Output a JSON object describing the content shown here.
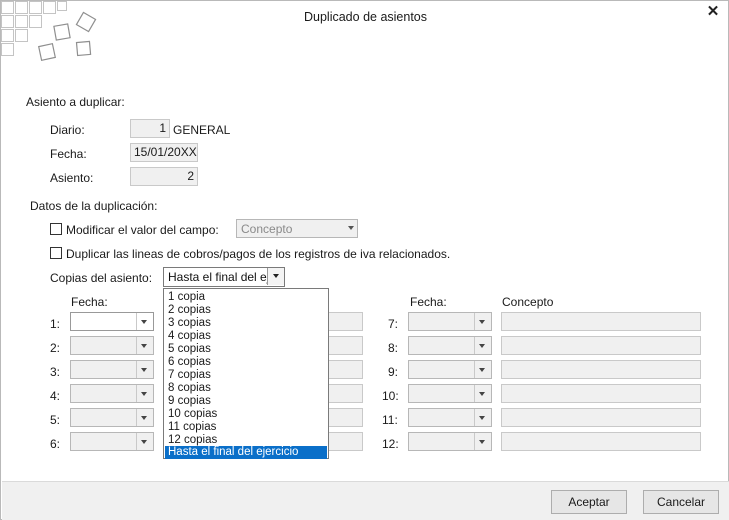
{
  "window": {
    "title": "Duplicado de asientos"
  },
  "section_source": {
    "heading": "Asiento a duplicar:",
    "diario_label": "Diario:",
    "diario_code": "1",
    "diario_name": "GENERAL",
    "fecha_label": "Fecha:",
    "fecha_value": "15/01/20XX",
    "asiento_label": "Asiento:",
    "asiento_value": "2"
  },
  "section_dup": {
    "heading": "Datos de la duplicación:",
    "modify_label": "Modificar el valor del campo:",
    "modify_combo_value": "Concepto",
    "duplicate_label": "Duplicar las lineas de cobros/pagos de los registros de iva relacionados.",
    "copies_label": "Copias del asiento:",
    "copies_value": "Hasta el final del ej",
    "copies_options": [
      "1 copia",
      "2 copias",
      "3 copias",
      "4 copias",
      "5 copias",
      "6 copias",
      "7 copias",
      "8 copias",
      "9 copias",
      "10 copias",
      "11 copias",
      "12 copias",
      "Hasta el final del ejercicio"
    ],
    "selected_option": "Hasta el final del ejercicio"
  },
  "grid": {
    "left_fecha_header": "Fecha:",
    "right_fecha_header": "Fecha:",
    "right_concepto_header": "Concepto",
    "left_rows": [
      "1:",
      "2:",
      "3:",
      "4:",
      "5:",
      "6:"
    ],
    "right_rows": [
      "7:",
      "8:",
      "9:",
      "10:",
      "11:",
      "12:"
    ]
  },
  "footer": {
    "accept_label": "Aceptar",
    "cancel_label": "Cancelar"
  },
  "colors": {
    "selection": "#0a6fc9",
    "footer_bg": "#f0f0f0"
  }
}
